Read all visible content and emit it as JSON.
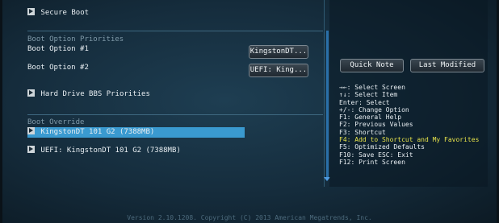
{
  "secure_boot": {
    "label": "Secure Boot"
  },
  "boot_option_priorities": {
    "heading": "Boot Option Priorities",
    "option1": {
      "label": "Boot Option #1",
      "value": "KingstonDT..."
    },
    "option2": {
      "label": "Boot Option #2",
      "value": "UEFI: King..."
    },
    "hdd_bbs": {
      "label": "Hard Drive BBS Priorities"
    }
  },
  "boot_override": {
    "heading": "Boot Override",
    "items": [
      {
        "label": "KingstonDT 101 G2  (7388MB)",
        "selected": true
      },
      {
        "label": "UEFI: KingstonDT 101 G2 (7388MB)",
        "selected": false
      }
    ]
  },
  "right_panel": {
    "quick_note_label": "Quick Note",
    "last_modified_label": "Last Modified",
    "help_lines": [
      {
        "text": "→←: Select Screen",
        "highlight": false
      },
      {
        "text": "↑↓: Select Item",
        "highlight": false
      },
      {
        "text": "Enter: Select",
        "highlight": false
      },
      {
        "text": "+/-: Change Option",
        "highlight": false
      },
      {
        "text": "F1: General Help",
        "highlight": false
      },
      {
        "text": "F2: Previous Values",
        "highlight": false
      },
      {
        "text": "F3: Shortcut",
        "highlight": false
      },
      {
        "text": "F4: Add to Shortcut and My Favorites",
        "highlight": true
      },
      {
        "text": "F5: Optimized Defaults",
        "highlight": false
      },
      {
        "text": "F10: Save  ESC: Exit",
        "highlight": false
      },
      {
        "text": "F12: Print Screen",
        "highlight": false
      }
    ]
  },
  "footer": {
    "text": "Version 2.10.1208. Copyright (C) 2013 American Megatrends, Inc."
  },
  "colors": {
    "accent": "#3a9ad0",
    "highlight_text": "#e6e24a"
  }
}
